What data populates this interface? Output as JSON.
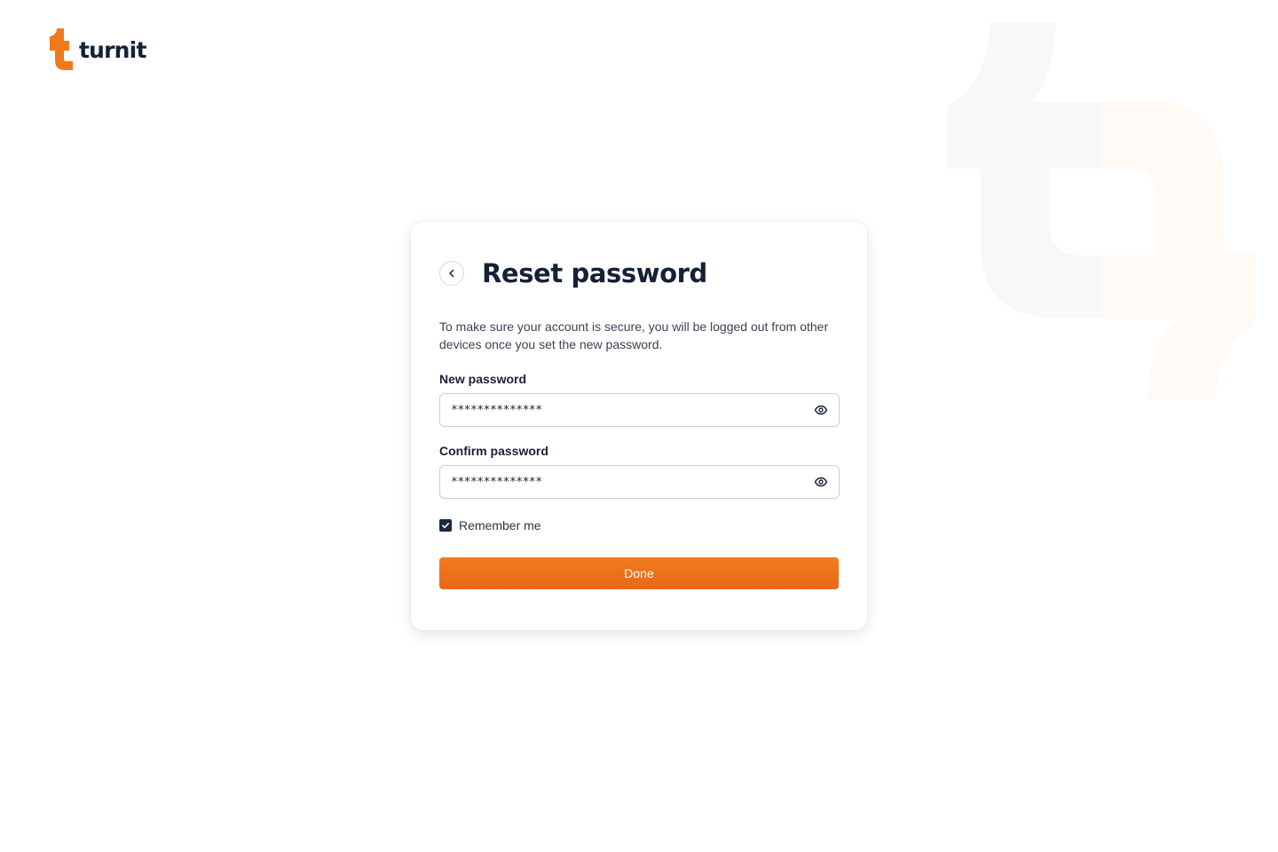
{
  "brand": {
    "name": "turnit",
    "colors": {
      "accent": "#EF7A1B",
      "navy": "#142136"
    }
  },
  "reset_form": {
    "title": "Reset password",
    "description": "To make sure your account is secure, you will be logged out from other devices once you set the new password.",
    "new_password": {
      "label": "New password",
      "value": "**************"
    },
    "confirm_password": {
      "label": "Confirm password",
      "value": "**************"
    },
    "remember_me": {
      "label": "Remember me",
      "checked": true
    },
    "submit_label": "Done"
  },
  "icons": [
    "back-chevron-icon",
    "eye-icon",
    "check-icon"
  ]
}
